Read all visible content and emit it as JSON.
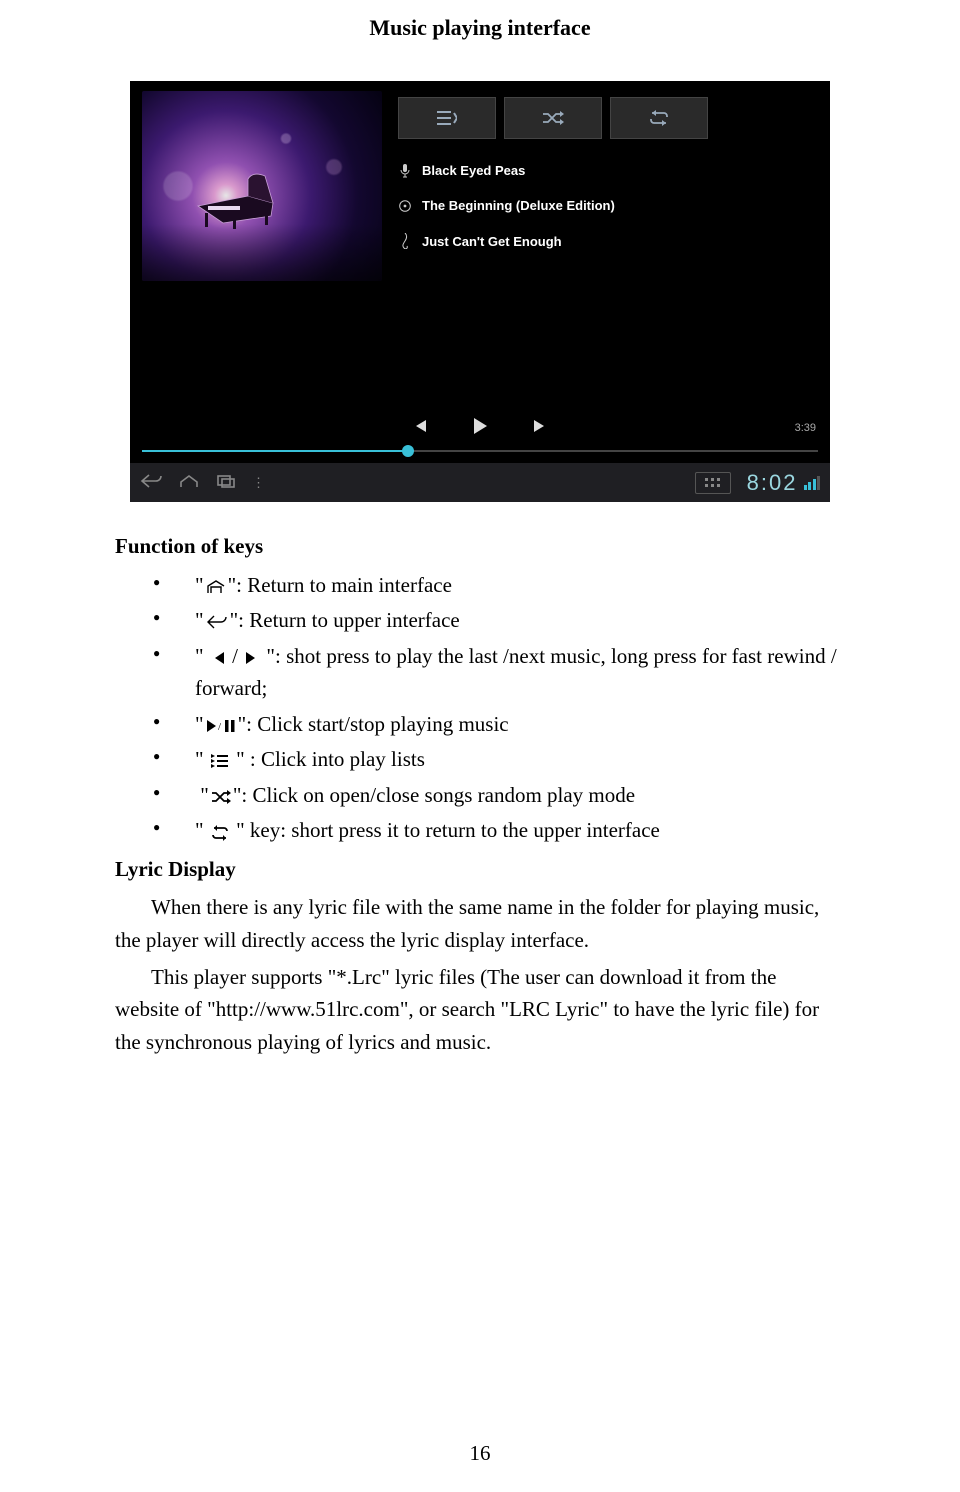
{
  "title": "Music playing interface",
  "player": {
    "artist": "Black Eyed Peas",
    "album": "The Beginning (Deluxe Edition)",
    "track": "Just Can't Get Enough",
    "duration": "3:39",
    "clock": "8:02"
  },
  "doc": {
    "fn_heading": "Function of keys",
    "b1": "\": Return to main interface",
    "b2": "\": Return to upper interface",
    "b3_a": "\"",
    "b3_slash": "/",
    "b3_b": "\": shot press to play the last /next music, long press for fast rewind / forward;",
    "b4": "\": Click start/stop playing music",
    "b5": "\" : Click into play lists",
    "b6": "\": Click on open/close songs random play mode",
    "b7": "\" key: short press it to return to the upper interface",
    "lyric_heading": "Lyric Display",
    "p1": "When there is any lyric file with the same name in the folder for playing music, the player will directly access the lyric display interface.",
    "p2": "This player supports \"*.Lrc\" lyric files (The user can download it from the website of \"http://www.51lrc.com\", or search \"LRC Lyric\" to have the lyric file) for the synchronous playing of lyrics and music.",
    "pagenum": "16"
  }
}
